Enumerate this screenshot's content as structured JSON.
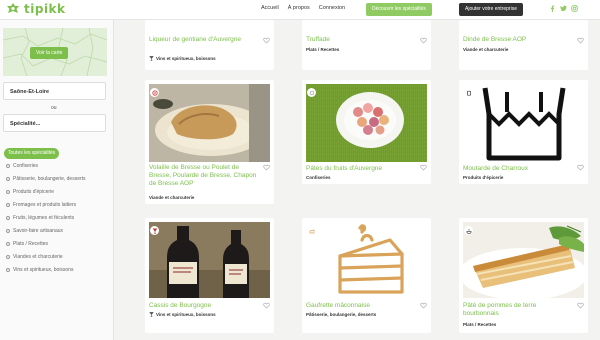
{
  "header": {
    "logo_text": "tipikk",
    "nav": [
      "Accueil",
      "À propos",
      "Connexion"
    ],
    "cta_primary": "Découvrir les spécialités",
    "cta_secondary": "Ajouter votre entreprise"
  },
  "sidebar": {
    "map_button": "Voir la carte",
    "department": "Saône-Et-Loire",
    "or_text": "ou",
    "speciality": "Spécialité...",
    "all_tag": "Toutes les spécialités",
    "categories": [
      "Confiseries",
      "Pâtisserie, boulangerie, desserts",
      "Produits d'épicerie",
      "Fromages et produits laitiers",
      "Fruits, légumes et féculents",
      "Savoir-faire artisanaux",
      "Plats / Recettes",
      "Viandes et charcuterie",
      "Vins et spiritueux, boissons"
    ]
  },
  "cards": [
    {
      "title": "Liqueur de gentiane d'Auvergne",
      "category": "Vins et spiritueux, boissons"
    },
    {
      "title": "Truffade",
      "category": "Plats / Recettes"
    },
    {
      "title": "Dinde de Bresse AOP",
      "category": "Viande et charcuterie"
    },
    {
      "title": "Volaille de Bresse ou Poulet de Bresse, Poularde de Bresse, Chapon de Bresse AOP",
      "category": "Viande et charcuterie"
    },
    {
      "title": "Pâtes du fruits d'Auvergne",
      "category": "Confiseries"
    },
    {
      "title": "Moutarde de Charroux",
      "category": "Produits d'épicerie"
    },
    {
      "title": "Cassis de Bourgogne",
      "category": "Vins et spiritueux, boissons"
    },
    {
      "title": "Gaufrette mâconnaise",
      "category": "Pâtisserie, boulangerie, desserts"
    },
    {
      "title": "Pâté de pommes de terre bourbonnais",
      "category": "Plats / Recettes"
    }
  ],
  "colors": {
    "accent": "#7cbf4a",
    "dark": "#333333"
  }
}
